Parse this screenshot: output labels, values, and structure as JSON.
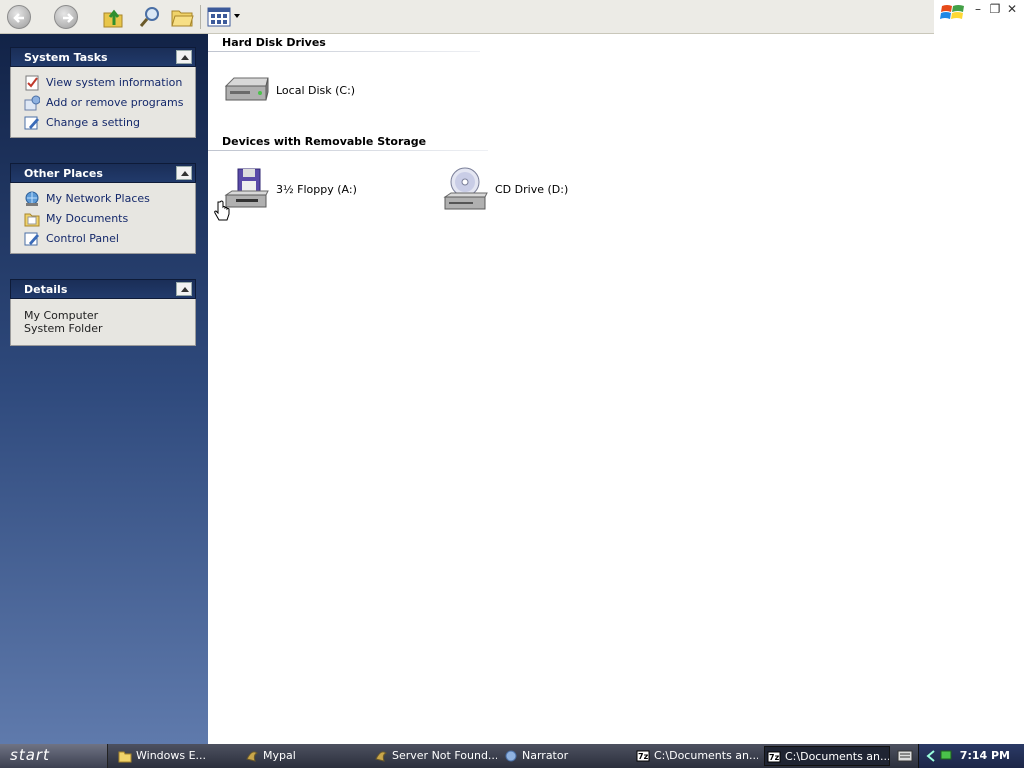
{
  "toolbar": {
    "back_icon": "back-arrow-icon",
    "forward_icon": "forward-arrow-icon",
    "up_icon": "folder-up-icon",
    "search_icon": "search-icon",
    "folders_icon": "folders-icon",
    "views_icon": "views-icon"
  },
  "sidebar": {
    "system_tasks": {
      "title": "System Tasks",
      "items": [
        {
          "label": "View system information",
          "icon": "system-info-icon"
        },
        {
          "label": "Add or remove programs",
          "icon": "add-remove-icon"
        },
        {
          "label": "Change a setting",
          "icon": "change-setting-icon"
        }
      ]
    },
    "other_places": {
      "title": "Other Places",
      "items": [
        {
          "label": "My Network Places",
          "icon": "network-icon"
        },
        {
          "label": "My Documents",
          "icon": "documents-icon"
        },
        {
          "label": "Control Panel",
          "icon": "control-panel-icon"
        }
      ]
    },
    "details": {
      "title": "Details",
      "name": "My Computer",
      "type": "System Folder"
    }
  },
  "main": {
    "hard_disk_group": "Hard Disk Drives",
    "removable_group": "Devices with Removable Storage",
    "drives": {
      "local_disk": "Local Disk (C:)",
      "floppy": "3½ Floppy (A:)",
      "cd": "CD Drive (D:)"
    }
  },
  "taskbar": {
    "start_label": "start",
    "items": [
      "Windows E...",
      "Mypal",
      "Server Not Found...",
      "Narrator",
      "C:\\Documents an...",
      "C:\\Documents an..."
    ],
    "clock": "7:14 PM"
  },
  "colors": {
    "sidebar_top": "#122347",
    "sidebar_bottom": "#5f7aac",
    "link": "#15296b",
    "taskbar": "#2b2f3c"
  }
}
